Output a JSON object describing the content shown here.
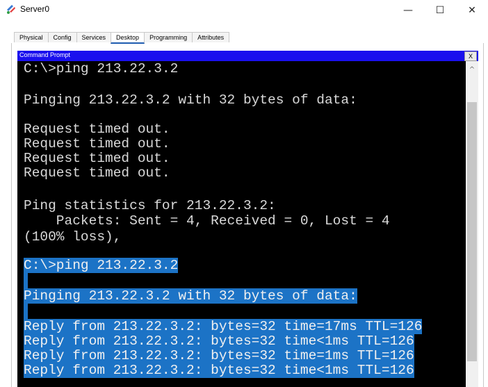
{
  "window": {
    "title": "Server0",
    "minimize": "—",
    "maximize": "☐",
    "close": "✕"
  },
  "tabs": [
    {
      "label": "Physical"
    },
    {
      "label": "Config"
    },
    {
      "label": "Services"
    },
    {
      "label": "Desktop",
      "active": true
    },
    {
      "label": "Programming"
    },
    {
      "label": "Attributes"
    }
  ],
  "command_prompt": {
    "title": "Command Prompt",
    "close_label": "X",
    "lines": [
      "C:\\>ping 213.22.3.2",
      "Pinging 213.22.3.2 with 32 bytes of data:",
      "Request timed out.",
      "Request timed out.",
      "Request timed out.",
      "Request timed out.",
      "Ping statistics for 213.22.3.2:",
      "    Packets: Sent = 4, Received = 0, Lost = 4",
      "(100% loss),",
      "C:\\>ping 213.22.3.2",
      "Pinging 213.22.3.2 with 32 bytes of data:",
      "Reply from 213.22.3.2: bytes=32 time=17ms TTL=126",
      "Reply from 213.22.3.2: bytes=32 time<1ms TTL=126",
      "Reply from 213.22.3.2: bytes=32 time=1ms TTL=126",
      "Reply from 213.22.3.2: bytes=32 time<1ms TTL=126"
    ]
  },
  "scrollbar": {
    "up_arrow": "^"
  },
  "colors": {
    "console_bg": "#000000",
    "console_text": "#d9d9d9",
    "selection": "#1c73c6",
    "cmd_titlebar": "#1a10ee"
  }
}
